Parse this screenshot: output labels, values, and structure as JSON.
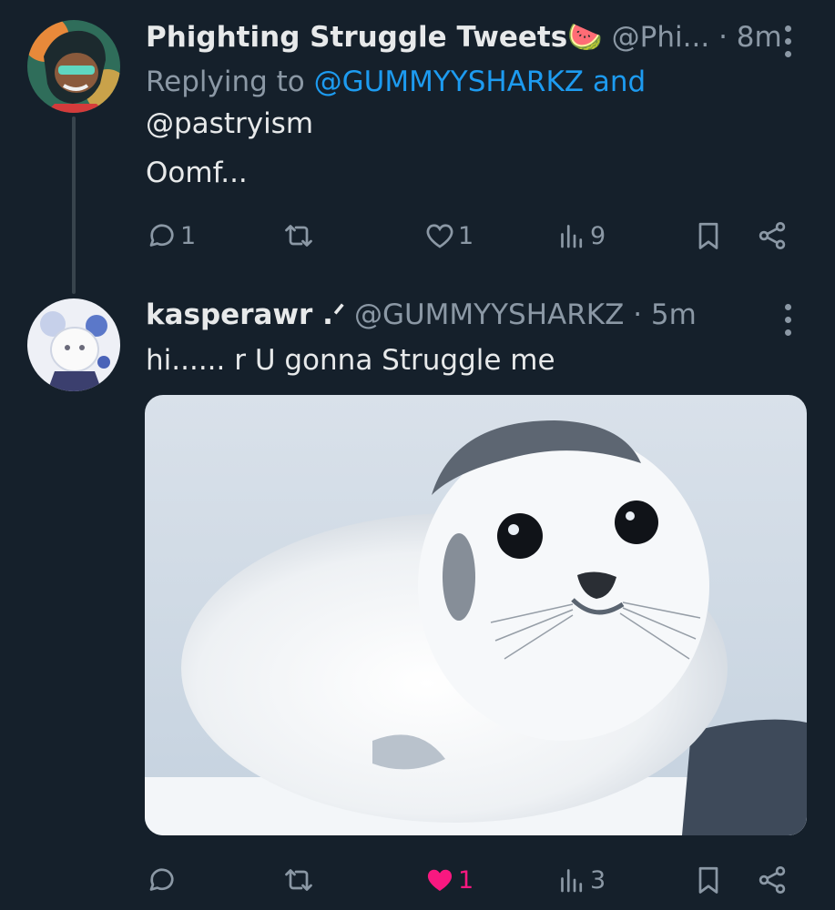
{
  "tweet1": {
    "display_name": "Phighting Struggle Tweets",
    "name_emoji": "🍉",
    "handle": "@Phi...",
    "time": "· 8m",
    "replying_prefix": "Replying to",
    "replying_users": "@GUMMYYSHARKZ and",
    "replying_users2": "@pastryism",
    "text": "Oomf...",
    "actions": {
      "replies": "1",
      "retweets": "",
      "likes": "1",
      "views": "9"
    }
  },
  "tweet2": {
    "display_name": "kasperawr .ᐟ",
    "handle": "@GUMMYYSHARKZ",
    "time": "· 5m",
    "text": "hi...... r U gonna Struggle me",
    "actions": {
      "replies": "",
      "retweets": "",
      "likes": "1",
      "views": "3",
      "liked": true
    }
  },
  "colors": {
    "background": "#15202b",
    "link": "#1d9bf0",
    "muted": "#8b98a5",
    "like_active": "#f91880"
  },
  "icons": [
    "more-icon",
    "reply-icon",
    "retweet-icon",
    "like-icon",
    "views-icon",
    "bookmark-icon",
    "share-icon"
  ]
}
